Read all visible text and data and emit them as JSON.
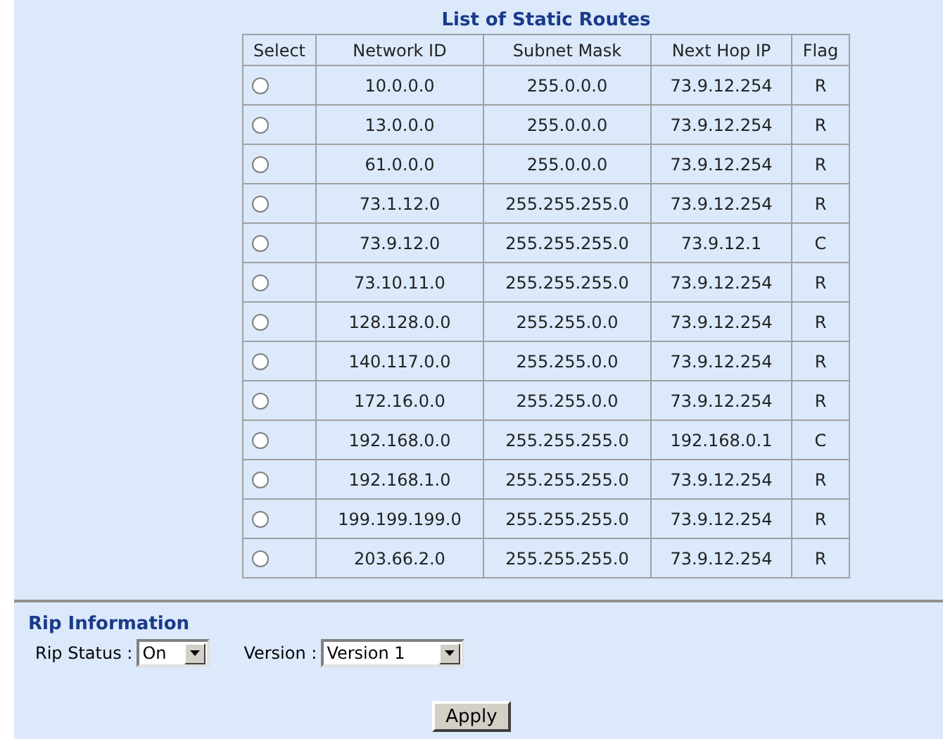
{
  "routes_table": {
    "title": "List of Static Routes",
    "columns": [
      "Select",
      "Network ID",
      "Subnet Mask",
      "Next Hop IP",
      "Flag"
    ],
    "rows": [
      {
        "selected": false,
        "network_id": "10.0.0.0",
        "subnet_mask": "255.0.0.0",
        "next_hop": "73.9.12.254",
        "flag": "R"
      },
      {
        "selected": false,
        "network_id": "13.0.0.0",
        "subnet_mask": "255.0.0.0",
        "next_hop": "73.9.12.254",
        "flag": "R"
      },
      {
        "selected": false,
        "network_id": "61.0.0.0",
        "subnet_mask": "255.0.0.0",
        "next_hop": "73.9.12.254",
        "flag": "R"
      },
      {
        "selected": false,
        "network_id": "73.1.12.0",
        "subnet_mask": "255.255.255.0",
        "next_hop": "73.9.12.254",
        "flag": "R"
      },
      {
        "selected": false,
        "network_id": "73.9.12.0",
        "subnet_mask": "255.255.255.0",
        "next_hop": "73.9.12.1",
        "flag": "C"
      },
      {
        "selected": false,
        "network_id": "73.10.11.0",
        "subnet_mask": "255.255.255.0",
        "next_hop": "73.9.12.254",
        "flag": "R"
      },
      {
        "selected": false,
        "network_id": "128.128.0.0",
        "subnet_mask": "255.255.0.0",
        "next_hop": "73.9.12.254",
        "flag": "R"
      },
      {
        "selected": false,
        "network_id": "140.117.0.0",
        "subnet_mask": "255.255.0.0",
        "next_hop": "73.9.12.254",
        "flag": "R"
      },
      {
        "selected": false,
        "network_id": "172.16.0.0",
        "subnet_mask": "255.255.0.0",
        "next_hop": "73.9.12.254",
        "flag": "R"
      },
      {
        "selected": false,
        "network_id": "192.168.0.0",
        "subnet_mask": "255.255.255.0",
        "next_hop": "192.168.0.1",
        "flag": "C"
      },
      {
        "selected": false,
        "network_id": "192.168.1.0",
        "subnet_mask": "255.255.255.0",
        "next_hop": "73.9.12.254",
        "flag": "R"
      },
      {
        "selected": false,
        "network_id": "199.199.199.0",
        "subnet_mask": "255.255.255.0",
        "next_hop": "73.9.12.254",
        "flag": "R"
      },
      {
        "selected": false,
        "network_id": "203.66.2.0",
        "subnet_mask": "255.255.255.0",
        "next_hop": "73.9.12.254",
        "flag": "R"
      }
    ]
  },
  "rip_information": {
    "title": "Rip Information",
    "rip_status": {
      "label": "Rip Status :",
      "value": "On"
    },
    "version": {
      "label": "Version :",
      "value": "Version 1"
    },
    "apply_button": "Apply"
  }
}
